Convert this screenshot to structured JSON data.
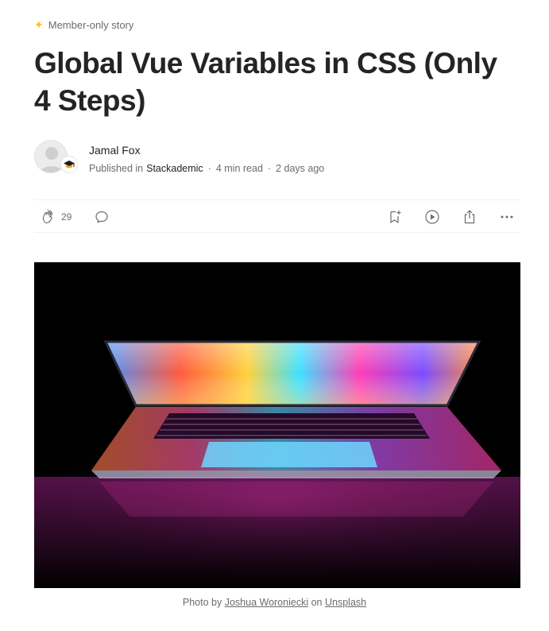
{
  "header": {
    "badge_label": "Member-only story",
    "star_icon": "sparkle-star-icon",
    "star_color": "#ffc017"
  },
  "article": {
    "title": "Global Vue Variables in CSS (Only 4 Steps)"
  },
  "author": {
    "name": "Jamal Fox",
    "published_in_label": "Published in",
    "publication": "Stackademic",
    "read_time": "4 min read",
    "date": "2 days ago",
    "separator": "·"
  },
  "actions": {
    "clap_count": "29",
    "icons": [
      "clap-icon",
      "comment-icon",
      "bookmark-add-icon",
      "play-icon",
      "share-icon",
      "more-icon"
    ]
  },
  "caption": {
    "prefix": "Photo by",
    "photographer": "Joshua Woroniecki",
    "on": "on",
    "source": "Unsplash"
  },
  "colors": {
    "text_primary": "#242424",
    "text_secondary": "#6b6b6b",
    "divider": "#f2f2f2"
  }
}
